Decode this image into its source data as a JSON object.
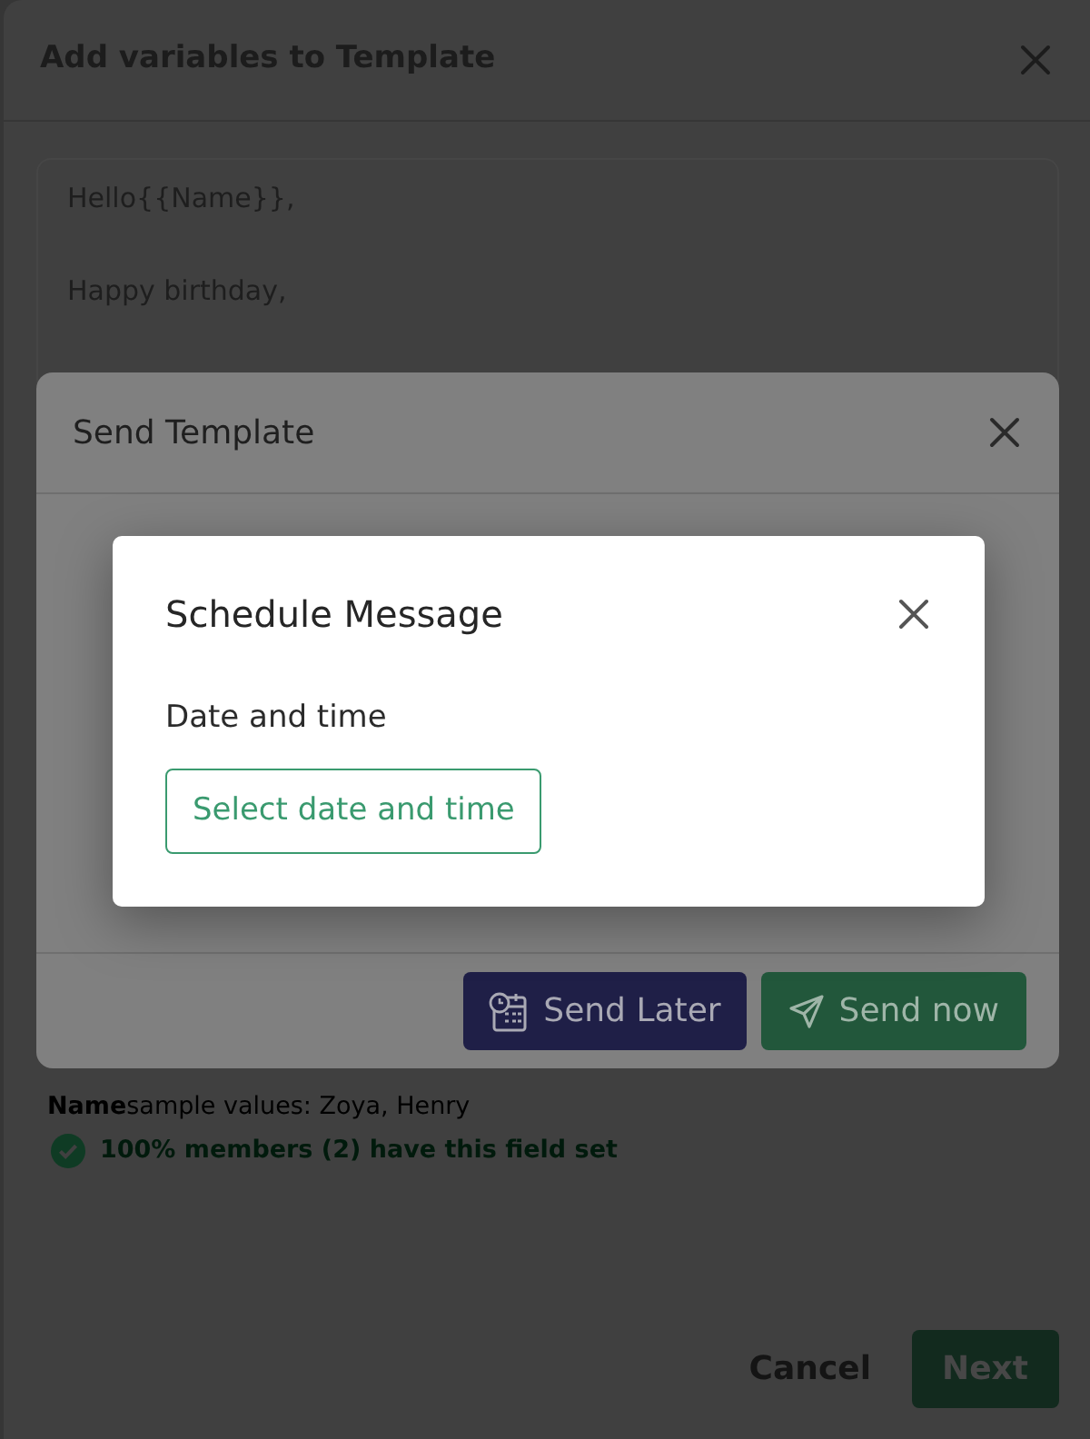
{
  "template_dialog": {
    "title": "Add variables to Template",
    "message_lines": [
      "Hello{{Name}},",
      "Happy birthday,"
    ],
    "variable": {
      "name": "Name",
      "sample_values": "sample values: Zoya, Henry",
      "coverage": "100% members (2) have this field set"
    },
    "cancel": "Cancel",
    "next": "Next"
  },
  "send_dialog": {
    "title": "Send Template",
    "send_later": "Send Later",
    "send_now": "Send now"
  },
  "schedule_dialog": {
    "title": "Schedule Message",
    "field_label": "Date and time",
    "picker_button": "Select date and time"
  }
}
